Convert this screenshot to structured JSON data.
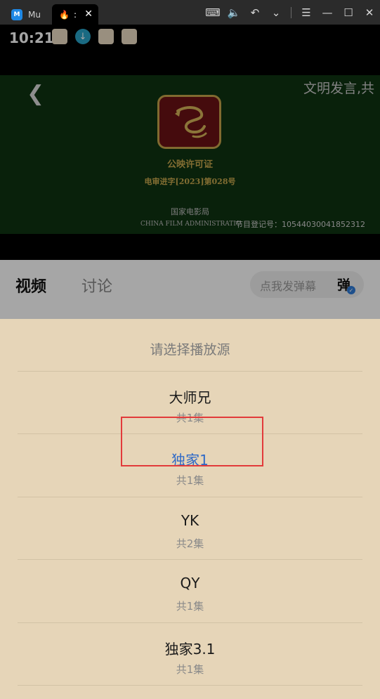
{
  "emulator": {
    "tabs": [
      {
        "label": "Mu",
        "logo": "M"
      },
      {
        "label": ":",
        "close": "✕"
      }
    ]
  },
  "statusbar": {
    "time": "10:21"
  },
  "player": {
    "marquee": "文明发言,共",
    "permit_title": "公映许可证",
    "permit_number": "电审进字[2023]第028号",
    "agency": "国家电影局",
    "agency_en": "CHINA FILM ADMINISTRATIO",
    "registration": "节目登记号：10544030041852312"
  },
  "tabs": {
    "video": "视频",
    "discuss": "讨论"
  },
  "danmaku": {
    "placeholder": "点我发弹幕",
    "button": "弹"
  },
  "sheet": {
    "title": "请选择播放源",
    "sources": [
      {
        "name": "大师兄",
        "count": "共1集"
      },
      {
        "name": "独家1",
        "count": "共1集",
        "selected": true
      },
      {
        "name": "YK",
        "count": "共2集"
      },
      {
        "name": "QY",
        "count": "共1集"
      },
      {
        "name": "独家3.1",
        "count": "共1集"
      }
    ]
  },
  "colors": {
    "sheet_bg": "#e6d5b8",
    "selected_text": "#2e69c7",
    "highlight_border": "#e23a3a"
  }
}
